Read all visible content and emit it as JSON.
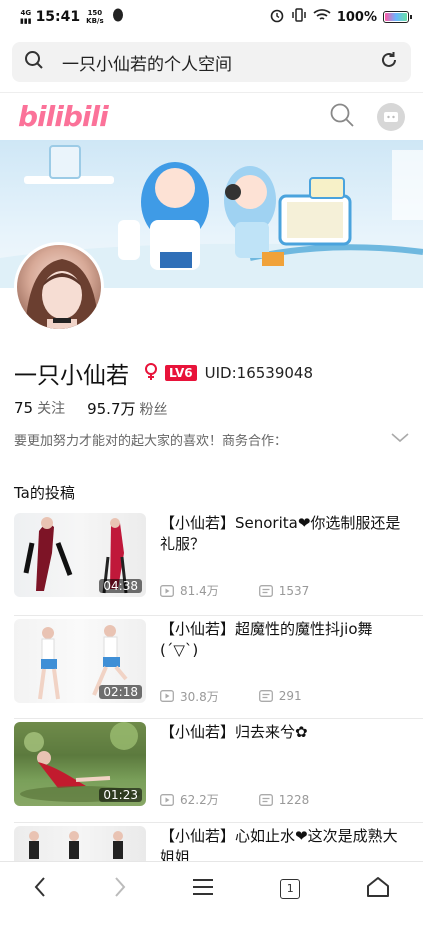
{
  "status": {
    "time": "15:41",
    "net_type": "4G",
    "net_speed": "150",
    "net_unit": "KB/s",
    "battery": "100%"
  },
  "browser": {
    "url_text": "一只小仙若的个人空间"
  },
  "site": {
    "logo": "bilibili"
  },
  "profile": {
    "name": "一只小仙若",
    "level": "LV6",
    "uid": "UID:16539048",
    "following_count": "75",
    "following_label": "关注",
    "followers_count": "95.7万",
    "followers_label": "粉丝",
    "signature": "要更加努力才能对的起大家的喜欢！商务合作："
  },
  "section_title": "Ta的投稿",
  "videos": [
    {
      "title": "【小仙若】Senorita❤你选制服还是礼服？",
      "duration": "04:38",
      "views": "81.4万",
      "danmaku": "1537"
    },
    {
      "title": "【小仙若】超魔性的魔性抖jio舞(´▽`)",
      "duration": "02:18",
      "views": "30.8万",
      "danmaku": "291"
    },
    {
      "title": "【小仙若】归去来兮✿",
      "duration": "01:23",
      "views": "62.2万",
      "danmaku": "1228"
    },
    {
      "title": "【小仙若】心如止水❤这次是成熟大姐姐",
      "duration": "",
      "views": "",
      "danmaku": ""
    }
  ],
  "nav": {
    "tab_count": "1"
  },
  "colors": {
    "brand": "#fb7299",
    "level_badge": "#e8133a",
    "gender_icon": "#e8133a"
  }
}
